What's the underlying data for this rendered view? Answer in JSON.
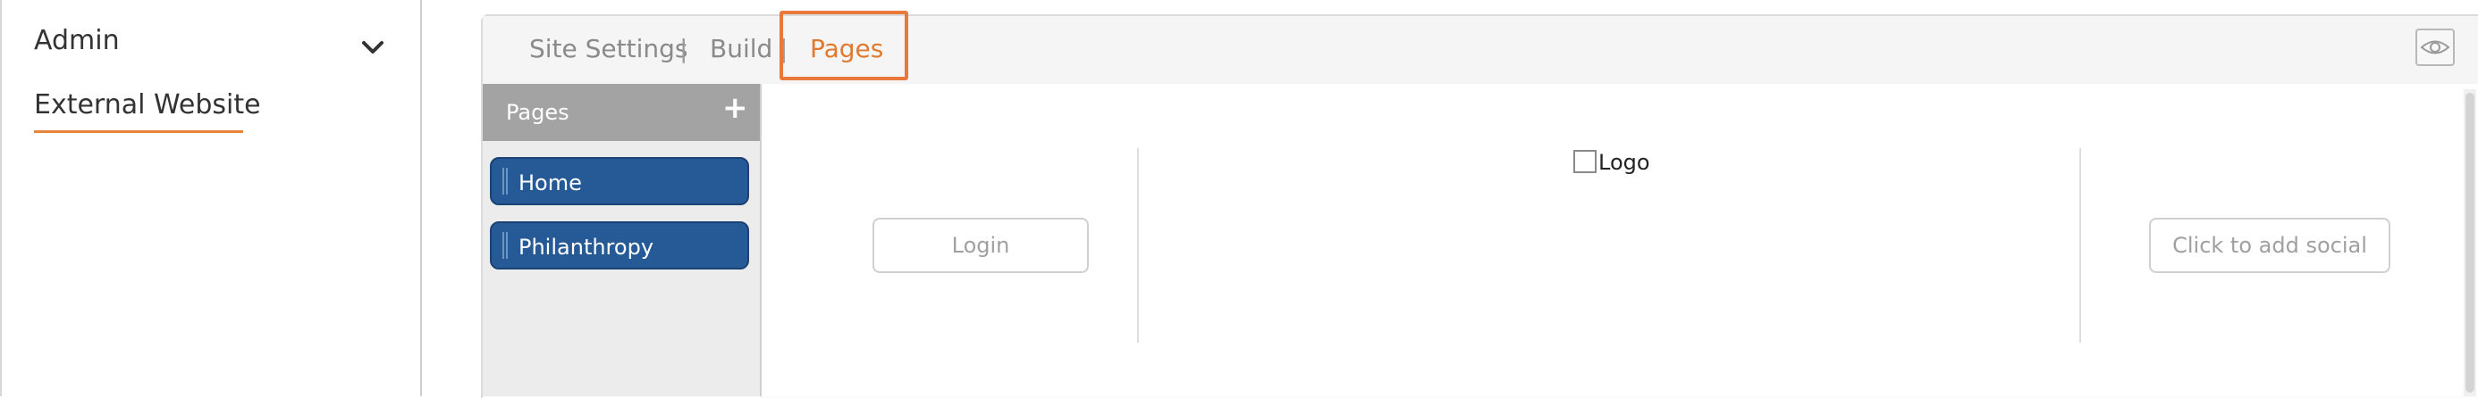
{
  "sidebar": {
    "items": [
      {
        "label": "Admin",
        "icon": "chevron-down-icon"
      },
      {
        "label": "External Website",
        "active": true
      }
    ]
  },
  "tabs": [
    {
      "label": "Site Settings"
    },
    {
      "label": "Build"
    },
    {
      "label": "Pages",
      "active": true
    }
  ],
  "tab_separator": "|",
  "toolbar": {
    "preview_icon": "eye-icon"
  },
  "pages_panel": {
    "title": "Pages",
    "add_icon": "plus-icon",
    "add_symbol": "+",
    "pages": [
      {
        "label": "Home"
      },
      {
        "label": "Philanthropy"
      }
    ]
  },
  "header_builder": {
    "login_label": "Login",
    "logo_label": "Logo",
    "social_label": "Click to add social"
  },
  "colors": {
    "accent": "#e8793a",
    "page_button": "#265a96",
    "pages_header": "#a3a3a3"
  }
}
